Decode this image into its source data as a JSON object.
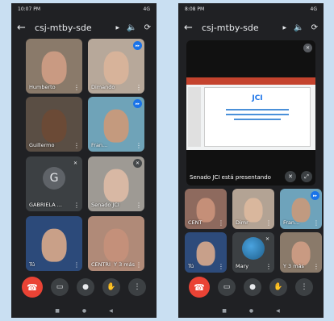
{
  "left_phone": {
    "status_time": "10:07 PM",
    "status_right": "4G",
    "meeting_code": "csj-mtby-sde",
    "tiles": [
      {
        "name": "Humberto",
        "bg": "#8a7a6a",
        "face": "#c99a82"
      },
      {
        "name": "Dimando",
        "bg": "#b7a89a",
        "face": "#d7b39a",
        "speaking": true
      },
      {
        "name": "Guillermo",
        "bg": "#5a4e44",
        "face": "#6b4a36"
      },
      {
        "name": "Fran...",
        "bg": "#6fa3b8",
        "face": "#c49a7e",
        "speaking": true
      },
      {
        "name": "GABRIELA ...",
        "avatar": "G",
        "muted": true
      },
      {
        "name": "Senado JCI",
        "bg": "#9e9a94",
        "face": "#d8b8a4",
        "muted": true
      },
      {
        "name": "Tú",
        "bg": "#2c4a7a",
        "face": "#c9a088"
      },
      {
        "name": "CENTRI",
        "bg": "#b08a78",
        "face": "#c4907a",
        "extra": "Y 3 más"
      }
    ]
  },
  "right_phone": {
    "status_time": "8:08 PM",
    "status_right": "4G",
    "meeting_code": "csj-mtby-sde",
    "slide_logo": "JCI",
    "presenting_text": "Senado JCI está presentando",
    "tiles": [
      {
        "name": "CENT",
        "bg": "#8e6a5e",
        "face": "#c58f78"
      },
      {
        "name": "Dimr",
        "bg": "#b3a394",
        "face": "#d9b79d"
      },
      {
        "name": "Fran...",
        "bg": "#6ea3bb",
        "face": "#c09a80",
        "speaking": true
      },
      {
        "name": "Tú",
        "bg": "#2d4b7b",
        "face": "#c8a08a"
      },
      {
        "name": "Mary",
        "avatar_earth": true,
        "muted": true
      },
      {
        "name": "Y 3 más",
        "bg": "#8a7a6a",
        "face": "#c99a82"
      }
    ]
  },
  "icons": {
    "back": "←",
    "speaker": "🔈",
    "switch_camera": "⟳",
    "end_call": "☎",
    "camera": "▭",
    "mic": "●",
    "hand": "✋",
    "more": "⋮",
    "mic_off": "✕",
    "speaking": "▸▸",
    "nav_square": "■",
    "nav_circle": "●",
    "nav_back": "◀"
  }
}
